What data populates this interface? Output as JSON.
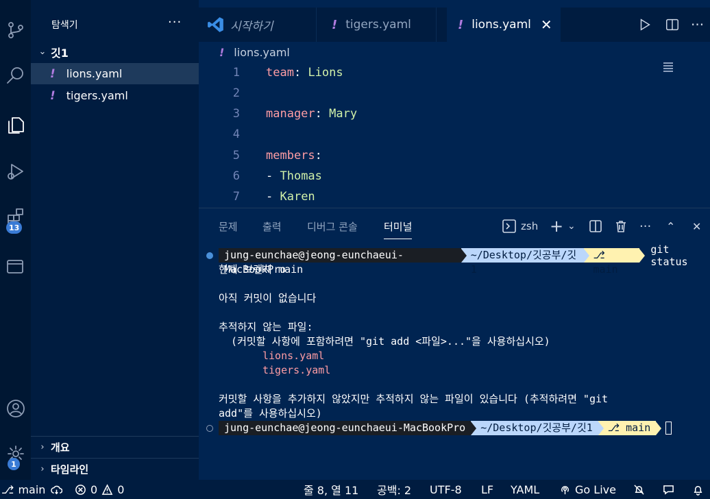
{
  "activity_bar": {
    "extensions_badge": "13",
    "settings_badge": "1"
  },
  "sidebar": {
    "title": "탐색기",
    "more": "···",
    "folder": "깃1",
    "files": [
      "lions.yaml",
      "tigers.yaml"
    ],
    "sections": [
      "개요",
      "타임라인"
    ]
  },
  "tabs": [
    {
      "label": "시작하기"
    },
    {
      "label": "tigers.yaml"
    },
    {
      "label": "lions.yaml",
      "active": true
    }
  ],
  "editor": {
    "breadcrumb": "lions.yaml",
    "lines": [
      {
        "n": "1",
        "key": "team",
        "value": "Lions"
      },
      {
        "n": "2"
      },
      {
        "n": "3",
        "key": "manager",
        "value": "Mary"
      },
      {
        "n": "4"
      },
      {
        "n": "5",
        "key": "members"
      },
      {
        "n": "6",
        "item": "Thomas"
      },
      {
        "n": "7",
        "item": "Karen"
      }
    ]
  },
  "panel": {
    "tabs": [
      "문제",
      "출력",
      "디버그 콘솔",
      "터미널"
    ],
    "shell": "zsh",
    "terminal": {
      "user": "jung-eunchae@jeong-eunchaeui-MacBookPro",
      "path": "~/Desktop/깃공부/깃1",
      "branch": "main",
      "command": "git status",
      "output": [
        "현재 브랜치 main",
        "",
        "아직 커밋이 없습니다",
        "",
        "추적하지 않는 파일:",
        "  (커밋할 사항에 포함하려면 \"git add <파일>...\"을 사용하십시오)"
      ],
      "untracked": [
        "lions.yaml",
        "tigers.yaml"
      ],
      "summary": [
        "커밋할 사항을 추가하지 않았지만 추적하지 않는 파일이 있습니다 (추적하려면 \"git",
        "add\"를 사용하십시오)"
      ]
    }
  },
  "statusbar": {
    "branch": "main",
    "errors": "0",
    "warnings": "0",
    "position": "줄 8, 열 11",
    "spaces": "공백: 2",
    "encoding": "UTF-8",
    "eol": "LF",
    "language": "YAML",
    "golive": "Go Live"
  },
  "colors": {
    "background": "#002451",
    "sidebar": "#001c40",
    "yaml_key": "#ff9da4",
    "yaml_value": "#d1f1a9",
    "yaml_icon": "#b07ce0",
    "badge": "#3a7bd5"
  }
}
